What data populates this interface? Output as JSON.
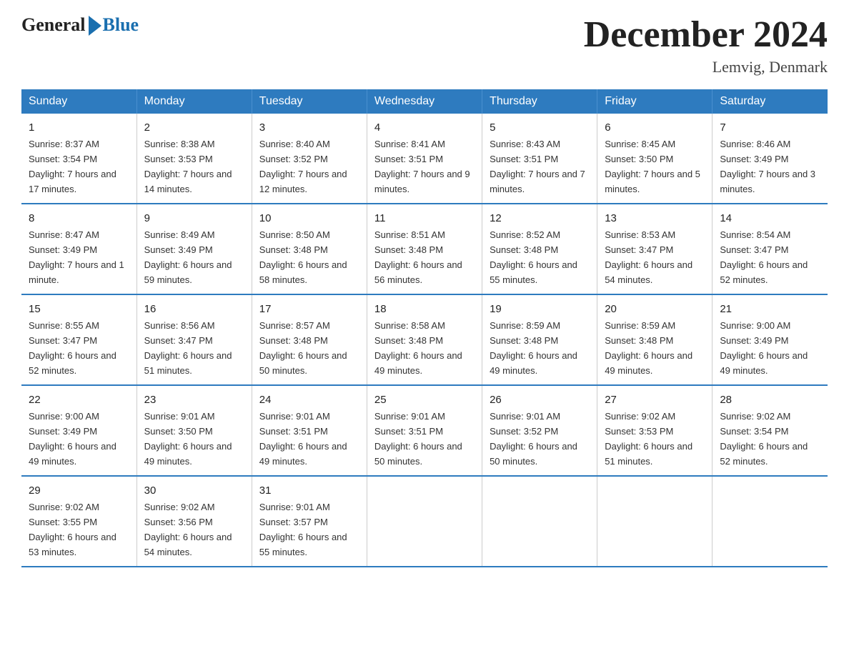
{
  "logo": {
    "general": "General",
    "blue": "Blue"
  },
  "title": {
    "month": "December 2024",
    "location": "Lemvig, Denmark"
  },
  "header_days": [
    "Sunday",
    "Monday",
    "Tuesday",
    "Wednesday",
    "Thursday",
    "Friday",
    "Saturday"
  ],
  "weeks": [
    [
      {
        "num": "1",
        "sunrise": "8:37 AM",
        "sunset": "3:54 PM",
        "daylight": "7 hours and 17 minutes."
      },
      {
        "num": "2",
        "sunrise": "8:38 AM",
        "sunset": "3:53 PM",
        "daylight": "7 hours and 14 minutes."
      },
      {
        "num": "3",
        "sunrise": "8:40 AM",
        "sunset": "3:52 PM",
        "daylight": "7 hours and 12 minutes."
      },
      {
        "num": "4",
        "sunrise": "8:41 AM",
        "sunset": "3:51 PM",
        "daylight": "7 hours and 9 minutes."
      },
      {
        "num": "5",
        "sunrise": "8:43 AM",
        "sunset": "3:51 PM",
        "daylight": "7 hours and 7 minutes."
      },
      {
        "num": "6",
        "sunrise": "8:45 AM",
        "sunset": "3:50 PM",
        "daylight": "7 hours and 5 minutes."
      },
      {
        "num": "7",
        "sunrise": "8:46 AM",
        "sunset": "3:49 PM",
        "daylight": "7 hours and 3 minutes."
      }
    ],
    [
      {
        "num": "8",
        "sunrise": "8:47 AM",
        "sunset": "3:49 PM",
        "daylight": "7 hours and 1 minute."
      },
      {
        "num": "9",
        "sunrise": "8:49 AM",
        "sunset": "3:49 PM",
        "daylight": "6 hours and 59 minutes."
      },
      {
        "num": "10",
        "sunrise": "8:50 AM",
        "sunset": "3:48 PM",
        "daylight": "6 hours and 58 minutes."
      },
      {
        "num": "11",
        "sunrise": "8:51 AM",
        "sunset": "3:48 PM",
        "daylight": "6 hours and 56 minutes."
      },
      {
        "num": "12",
        "sunrise": "8:52 AM",
        "sunset": "3:48 PM",
        "daylight": "6 hours and 55 minutes."
      },
      {
        "num": "13",
        "sunrise": "8:53 AM",
        "sunset": "3:47 PM",
        "daylight": "6 hours and 54 minutes."
      },
      {
        "num": "14",
        "sunrise": "8:54 AM",
        "sunset": "3:47 PM",
        "daylight": "6 hours and 52 minutes."
      }
    ],
    [
      {
        "num": "15",
        "sunrise": "8:55 AM",
        "sunset": "3:47 PM",
        "daylight": "6 hours and 52 minutes."
      },
      {
        "num": "16",
        "sunrise": "8:56 AM",
        "sunset": "3:47 PM",
        "daylight": "6 hours and 51 minutes."
      },
      {
        "num": "17",
        "sunrise": "8:57 AM",
        "sunset": "3:48 PM",
        "daylight": "6 hours and 50 minutes."
      },
      {
        "num": "18",
        "sunrise": "8:58 AM",
        "sunset": "3:48 PM",
        "daylight": "6 hours and 49 minutes."
      },
      {
        "num": "19",
        "sunrise": "8:59 AM",
        "sunset": "3:48 PM",
        "daylight": "6 hours and 49 minutes."
      },
      {
        "num": "20",
        "sunrise": "8:59 AM",
        "sunset": "3:48 PM",
        "daylight": "6 hours and 49 minutes."
      },
      {
        "num": "21",
        "sunrise": "9:00 AM",
        "sunset": "3:49 PM",
        "daylight": "6 hours and 49 minutes."
      }
    ],
    [
      {
        "num": "22",
        "sunrise": "9:00 AM",
        "sunset": "3:49 PM",
        "daylight": "6 hours and 49 minutes."
      },
      {
        "num": "23",
        "sunrise": "9:01 AM",
        "sunset": "3:50 PM",
        "daylight": "6 hours and 49 minutes."
      },
      {
        "num": "24",
        "sunrise": "9:01 AM",
        "sunset": "3:51 PM",
        "daylight": "6 hours and 49 minutes."
      },
      {
        "num": "25",
        "sunrise": "9:01 AM",
        "sunset": "3:51 PM",
        "daylight": "6 hours and 50 minutes."
      },
      {
        "num": "26",
        "sunrise": "9:01 AM",
        "sunset": "3:52 PM",
        "daylight": "6 hours and 50 minutes."
      },
      {
        "num": "27",
        "sunrise": "9:02 AM",
        "sunset": "3:53 PM",
        "daylight": "6 hours and 51 minutes."
      },
      {
        "num": "28",
        "sunrise": "9:02 AM",
        "sunset": "3:54 PM",
        "daylight": "6 hours and 52 minutes."
      }
    ],
    [
      {
        "num": "29",
        "sunrise": "9:02 AM",
        "sunset": "3:55 PM",
        "daylight": "6 hours and 53 minutes."
      },
      {
        "num": "30",
        "sunrise": "9:02 AM",
        "sunset": "3:56 PM",
        "daylight": "6 hours and 54 minutes."
      },
      {
        "num": "31",
        "sunrise": "9:01 AM",
        "sunset": "3:57 PM",
        "daylight": "6 hours and 55 minutes."
      },
      null,
      null,
      null,
      null
    ]
  ]
}
